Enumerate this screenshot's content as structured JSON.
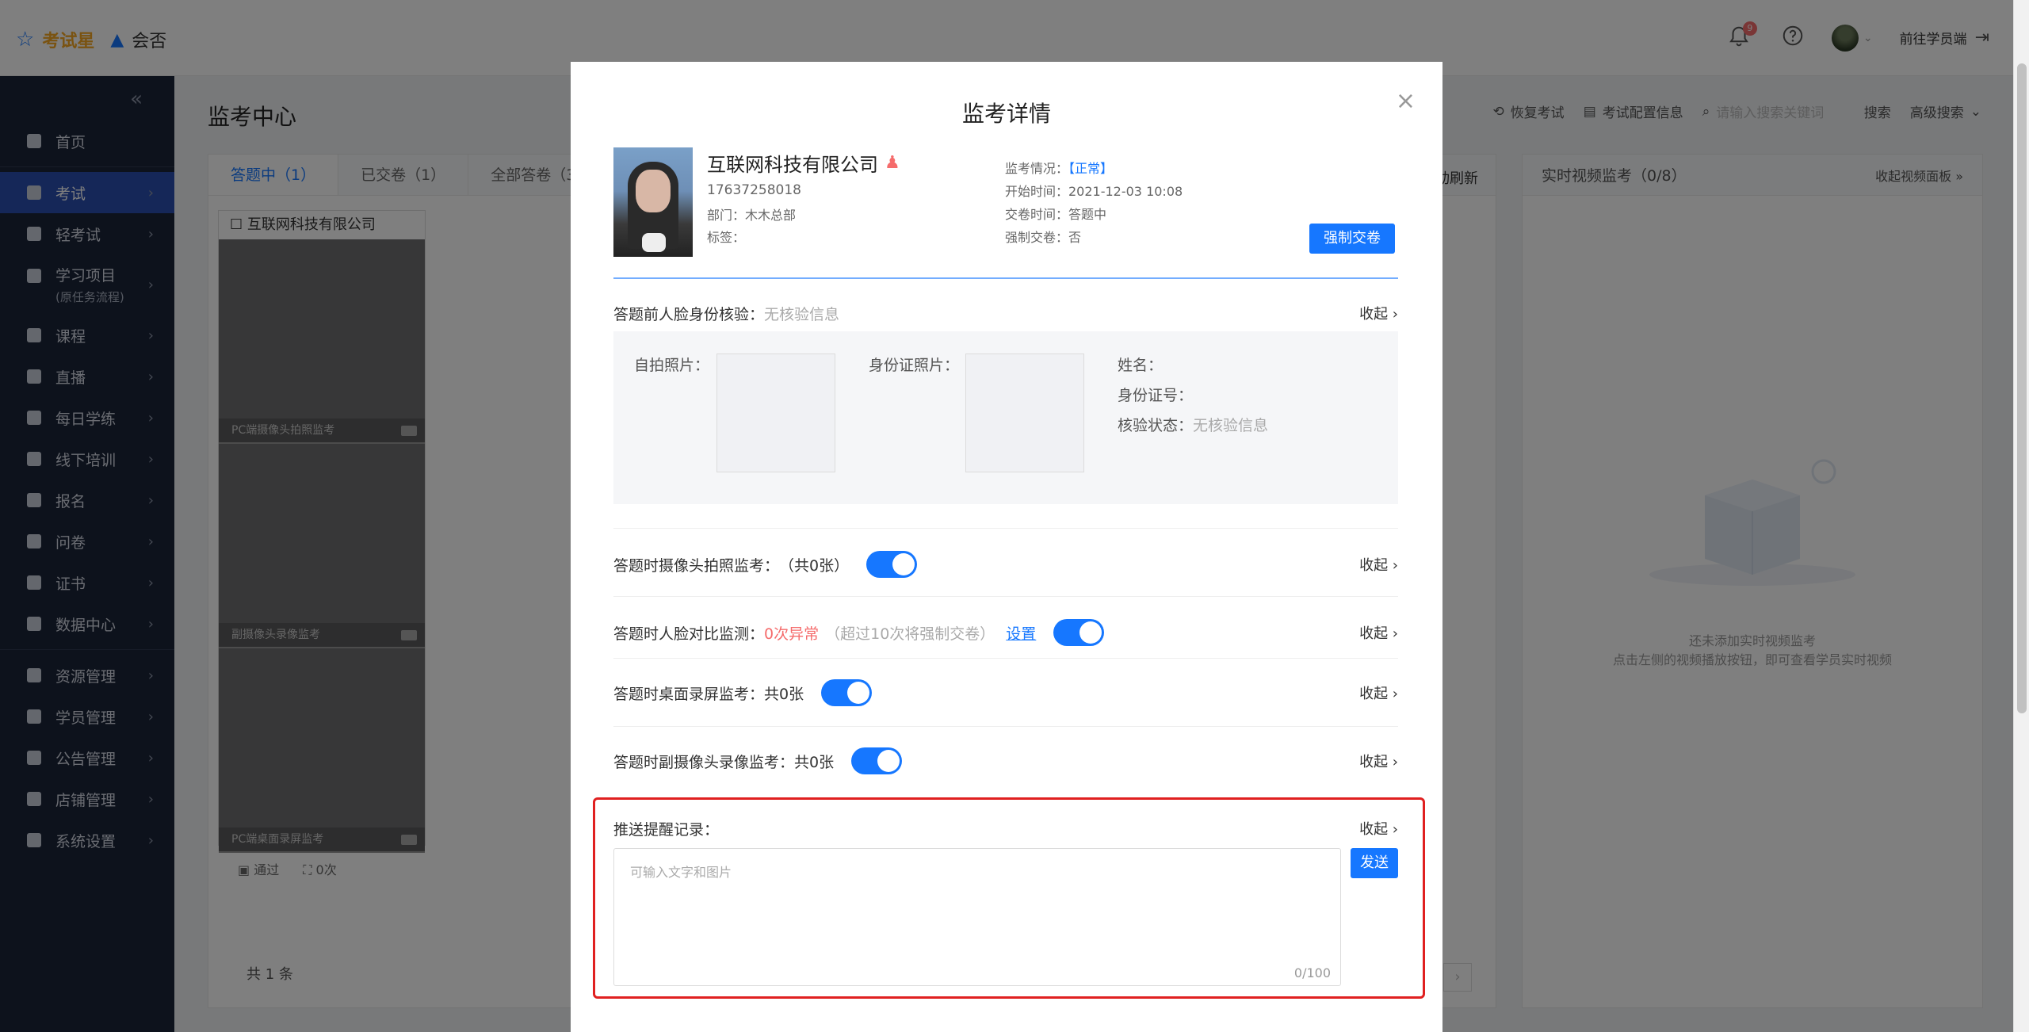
{
  "topbar": {
    "brand1": "考试星",
    "brand2": "会否",
    "notification_count": "9",
    "goto_student": "前往学员端"
  },
  "sidebar": {
    "items": [
      {
        "label": "首页"
      },
      {
        "label": "考试",
        "active": true
      },
      {
        "label": "轻考试"
      },
      {
        "label": "学习项目",
        "sub": "(原任务流程)"
      },
      {
        "label": "课程"
      },
      {
        "label": "直播"
      },
      {
        "label": "每日学练"
      },
      {
        "label": "线下培训"
      },
      {
        "label": "报名"
      },
      {
        "label": "问卷"
      },
      {
        "label": "证书"
      },
      {
        "label": "数据中心"
      },
      {
        "label": "资源管理"
      },
      {
        "label": "学员管理"
      },
      {
        "label": "公告管理"
      },
      {
        "label": "店铺管理"
      },
      {
        "label": "系统设置"
      }
    ]
  },
  "page": {
    "title": "监考中心",
    "toolbar": {
      "restore": "恢复考试",
      "config": "考试配置信息",
      "search_placeholder": "请输入搜索关键词",
      "search": "搜索",
      "advanced": "高级搜索"
    },
    "tabs": [
      "答题中（1）",
      "已交卷（1）",
      "全部答卷（3"
    ],
    "refresh": "动刷新",
    "student_name": "互联网科技有限公司",
    "cams": [
      "PC端摄像头拍照监考",
      "副摄像头录像监考",
      "PC端桌面录屏监考"
    ],
    "foot_pass": "通过",
    "foot_count": "0次",
    "total": "共 1 条",
    "video_panel": {
      "title": "实时视频监考（0/8）",
      "collapse": "收起视频面板",
      "empty1": "还未添加实时视频监考",
      "empty2": "点击左侧的视频播放按钮，即可查看学员实时视频"
    }
  },
  "modal": {
    "title": "监考详情",
    "profile": {
      "name": "互联网科技有限公司",
      "phone": "17637258018",
      "dept": "部门：木木总部",
      "tag": "标签：",
      "status_label": "监考情况：",
      "status_value": "【正常】",
      "start": "开始时间：2021-12-03 10:08",
      "submit": "交卷时间：答题中",
      "force": "强制交卷：否",
      "force_btn": "强制交卷"
    },
    "face_verify": {
      "label": "答题前人脸身份核验：",
      "value": "无核验信息",
      "collapse": "收起",
      "selfie": "自拍照片：",
      "idcard": "身份证照片：",
      "name": "姓名：",
      "idno": "身份证号：",
      "status": "核验状态：",
      "status_value": "无核验信息"
    },
    "camera_photo": {
      "label": "答题时摄像头拍照监考：",
      "value": "（共0张）",
      "collapse": "收起"
    },
    "face_compare": {
      "label": "答题时人脸对比监测：",
      "value": "0次异常",
      "hint": "（超过10次将强制交卷）",
      "setting": "设置",
      "collapse": "收起"
    },
    "desktop": {
      "label": "答题时桌面录屏监考：",
      "value": "共0张",
      "collapse": "收起"
    },
    "sub_camera": {
      "label": "答题时副摄像头录像监考：",
      "value": "共0张",
      "collapse": "收起"
    },
    "push": {
      "label": "推送提醒记录：",
      "collapse": "收起",
      "placeholder": "可输入文字和图片",
      "counter": "0/100",
      "send": "发送"
    }
  },
  "colors": {
    "primary": "#1677ff",
    "danger": "#f56c6c",
    "sidebar": "#1b2438",
    "highlight": "#e02020"
  }
}
